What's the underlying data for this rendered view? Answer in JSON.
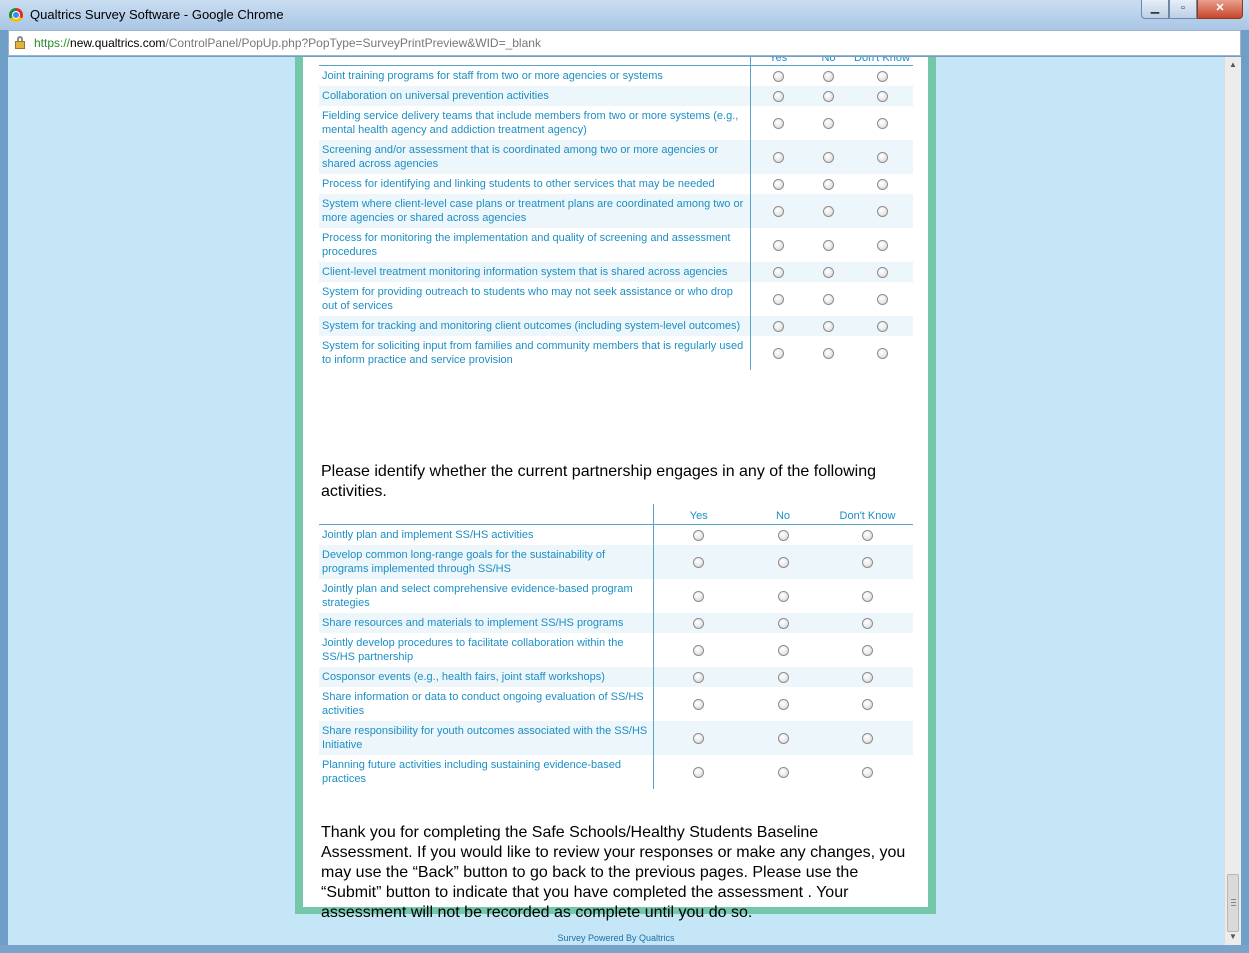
{
  "window": {
    "title": "Qualtrics Survey Software - Google Chrome",
    "minimize": "▁",
    "maximize": "▫",
    "close": "✕"
  },
  "address": {
    "scheme": "https://",
    "host": "new.qualtrics.com",
    "path": "/ControlPanel/PopUp.php?PopType=SurveyPrintPreview&WID=_blank"
  },
  "matrix1": {
    "column_labels": [
      "Yes",
      "No",
      "Don't Know"
    ],
    "rows": [
      "Joint training programs for staff from two or more agencies or systems",
      "Collaboration on universal prevention activities",
      "Fielding service delivery teams that include members from two or more systems (e.g., mental health agency and addiction treatment agency)",
      "Screening and/or assessment that is coordinated among two or more agencies or shared across agencies",
      "Process for identifying and linking students to other services that may be needed",
      "System where client-level case plans or treatment plans are coordinated among two or more agencies or shared across agencies",
      "Process for monitoring the implementation and quality of screening and assessment procedures",
      "Client-level treatment monitoring information system that is shared across agencies",
      "System for providing outreach to students who may not seek assistance or who drop out of services",
      "System for tracking and monitoring client outcomes (including system-level outcomes)",
      "System for soliciting input from families and community members that is regularly used to inform practice and service provision"
    ]
  },
  "question2": {
    "text": "Please identify whether the current partnership engages in any of the following activities.",
    "column_labels": [
      "Yes",
      "No",
      "Don't Know"
    ],
    "rows": [
      "Jointly plan and implement SS/HS activities",
      "Develop common long-range goals for the sustainability of programs implemented through SS/HS",
      "Jointly plan and select comprehensive evidence-based program strategies",
      "Share resources and materials to implement SS/HS programs",
      "Jointly develop procedures to facilitate collaboration within the SS/HS partnership",
      "Cosponsor events (e.g., health fairs, joint staff workshops)",
      "Share information or data to conduct ongoing evaluation of SS/HS activities",
      "Share responsibility for youth outcomes associated with the SS/HS Initiative",
      "Planning future activities including sustaining evidence-based practices"
    ]
  },
  "closing": {
    "text": "Thank you for completing the Safe Schools/Healthy Students Baseline Assessment. If you would like to review your responses or make any changes, you may use the “Back” button to go back to the previous pages. Please use the “Submit” button to indicate that you have completed the assessment . Your assessment will not be recorded as complete until you do so."
  },
  "footer": {
    "powered_by": "Survey Powered By Qualtrics"
  },
  "colors": {
    "accent_text": "#1c8fc4",
    "frame_green": "#74c7a9",
    "page_bg": "#c4e6f6"
  }
}
